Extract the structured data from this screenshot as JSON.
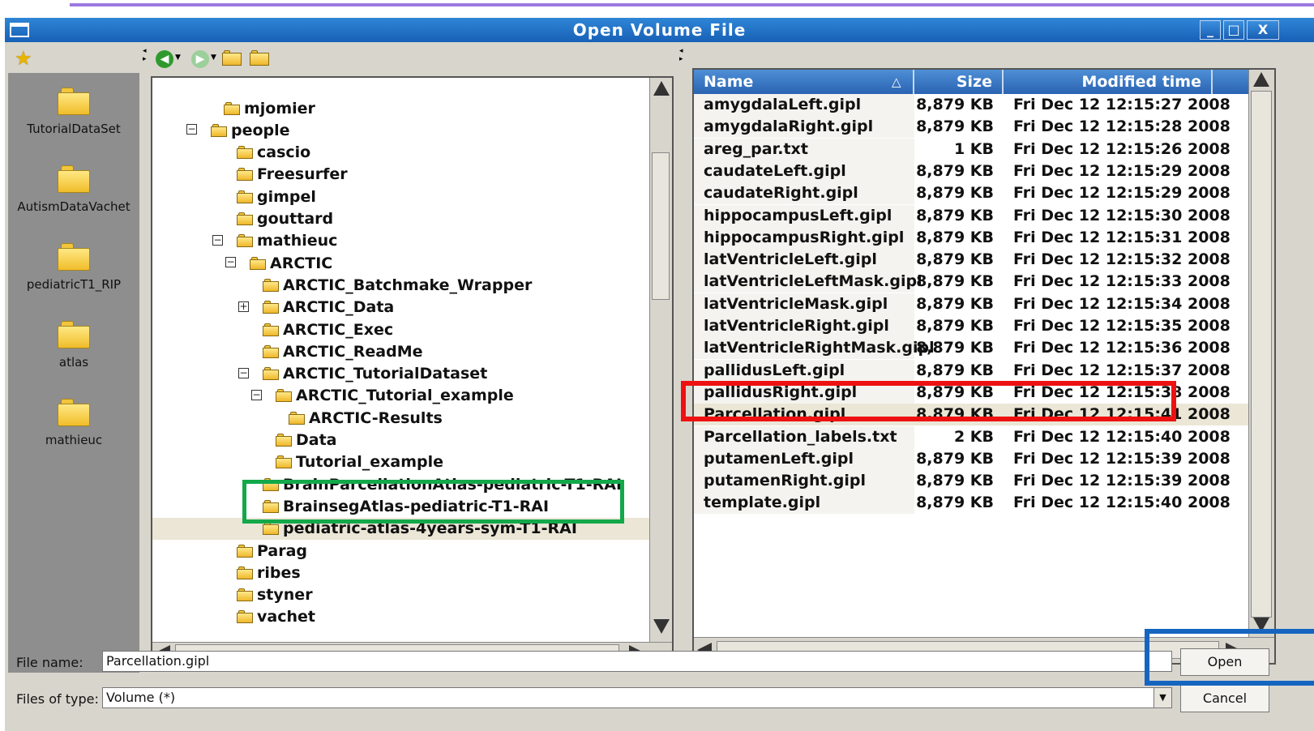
{
  "window": {
    "title": "Open Volume File",
    "controls": {
      "minimize": "_",
      "maximize": "□",
      "close": "X"
    },
    "titlebar_color": "#1f6fc4"
  },
  "places": [
    {
      "label": "TutorialDataSet",
      "icon": "folder-icon"
    },
    {
      "label": "AutismDataVachet",
      "icon": "folder-icon"
    },
    {
      "label": "pediatricT1_RIP",
      "icon": "folder-icon"
    },
    {
      "label": "atlas",
      "icon": "folder-icon"
    },
    {
      "label": "mathieuc",
      "icon": "folder-icon"
    }
  ],
  "toolbar": {
    "bookmark_icon": "star-icon",
    "back_icon": "back-arrow-icon",
    "forward_icon": "forward-arrow-icon",
    "up_icon": "folder-up-icon",
    "new_folder_icon": "new-folder-icon"
  },
  "tree": [
    {
      "label": "mjomier",
      "toggle": ""
    },
    {
      "label": "people",
      "toggle": "⊟"
    },
    {
      "label": "cascio",
      "toggle": ""
    },
    {
      "label": "Freesurfer",
      "toggle": ""
    },
    {
      "label": "gimpel",
      "toggle": ""
    },
    {
      "label": "gouttard",
      "toggle": ""
    },
    {
      "label": "mathieuc",
      "toggle": "⊟"
    },
    {
      "label": "ARCTIC",
      "toggle": "⊟"
    },
    {
      "label": "ARCTIC_Batchmake_Wrapper",
      "toggle": ""
    },
    {
      "label": "ARCTIC_Data",
      "toggle": "⊞"
    },
    {
      "label": "ARCTIC_Exec",
      "toggle": ""
    },
    {
      "label": "ARCTIC_ReadMe",
      "toggle": ""
    },
    {
      "label": "ARCTIC_TutorialDataset",
      "toggle": "⊟"
    },
    {
      "label": "ARCTIC_Tutorial_example",
      "toggle": "⊟"
    },
    {
      "label": "ARCTIC-Results",
      "toggle": ""
    },
    {
      "label": "Data",
      "toggle": ""
    },
    {
      "label": "Tutorial_example",
      "toggle": ""
    },
    {
      "label": "BrainParcellationAtlas-pediatric-T1-RAI",
      "toggle": ""
    },
    {
      "label": "BrainsegAtlas-pediatric-T1-RAI",
      "toggle": ""
    },
    {
      "label": "pediatric-atlas-4years-sym-T1-RAI",
      "toggle": "",
      "selected": true
    },
    {
      "label": "Parag",
      "toggle": ""
    },
    {
      "label": "ribes",
      "toggle": ""
    },
    {
      "label": "styner",
      "toggle": ""
    },
    {
      "label": "vachet",
      "toggle": ""
    }
  ],
  "file_list": {
    "columns": {
      "name": "Name",
      "size": "Size",
      "modified": "Modified time",
      "sort_indicator": "△"
    },
    "rows": [
      {
        "name": "amygdalaLeft.gipl",
        "size": "8,879 KB",
        "modified": "Fri Dec 12 12:15:27 2008"
      },
      {
        "name": "amygdalaRight.gipl",
        "size": "8,879 KB",
        "modified": "Fri Dec 12 12:15:28 2008"
      },
      {
        "name": "areg_par.txt",
        "size": "1 KB",
        "modified": "Fri Dec 12 12:15:26 2008"
      },
      {
        "name": "caudateLeft.gipl",
        "size": "8,879 KB",
        "modified": "Fri Dec 12 12:15:29 2008"
      },
      {
        "name": "caudateRight.gipl",
        "size": "8,879 KB",
        "modified": "Fri Dec 12 12:15:29 2008"
      },
      {
        "name": "hippocampusLeft.gipl",
        "size": "8,879 KB",
        "modified": "Fri Dec 12 12:15:30 2008"
      },
      {
        "name": "hippocampusRight.gipl",
        "size": "8,879 KB",
        "modified": "Fri Dec 12 12:15:31 2008"
      },
      {
        "name": "latVentricleLeft.gipl",
        "size": "8,879 KB",
        "modified": "Fri Dec 12 12:15:32 2008"
      },
      {
        "name": "latVentricleLeftMask.gipl",
        "size": "8,879 KB",
        "modified": "Fri Dec 12 12:15:33 2008"
      },
      {
        "name": "latVentricleMask.gipl",
        "size": "8,879 KB",
        "modified": "Fri Dec 12 12:15:34 2008"
      },
      {
        "name": "latVentricleRight.gipl",
        "size": "8,879 KB",
        "modified": "Fri Dec 12 12:15:35 2008"
      },
      {
        "name": "latVentricleRightMask.gipl",
        "size": "8,879 KB",
        "modified": "Fri Dec 12 12:15:36 2008"
      },
      {
        "name": "pallidusLeft.gipl",
        "size": "8,879 KB",
        "modified": "Fri Dec 12 12:15:37 2008"
      },
      {
        "name": "pallidusRight.gipl",
        "size": "8,879 KB",
        "modified": "Fri Dec 12 12:15:38 2008"
      },
      {
        "name": "Parcellation.gipl",
        "size": "8,879 KB",
        "modified": "Fri Dec 12 12:15:41 2008",
        "selected": true
      },
      {
        "name": "Parcellation_labels.txt",
        "size": "2 KB",
        "modified": "Fri Dec 12 12:15:40 2008"
      },
      {
        "name": "putamenLeft.gipl",
        "size": "8,879 KB",
        "modified": "Fri Dec 12 12:15:39 2008"
      },
      {
        "name": "putamenRight.gipl",
        "size": "8,879 KB",
        "modified": "Fri Dec 12 12:15:39 2008"
      },
      {
        "name": "template.gipl",
        "size": "8,879 KB",
        "modified": "Fri Dec 12 12:15:40 2008"
      }
    ]
  },
  "form": {
    "file_name_label": "File name:",
    "file_name_value": "Parcellation.gipl",
    "file_type_label": "Files of type:",
    "file_type_value": "Volume (*)",
    "open_label": "Open",
    "cancel_label": "Cancel"
  },
  "highlights": {
    "red": "#ee1111",
    "green": "#13a84a",
    "blue": "#1565c0"
  }
}
